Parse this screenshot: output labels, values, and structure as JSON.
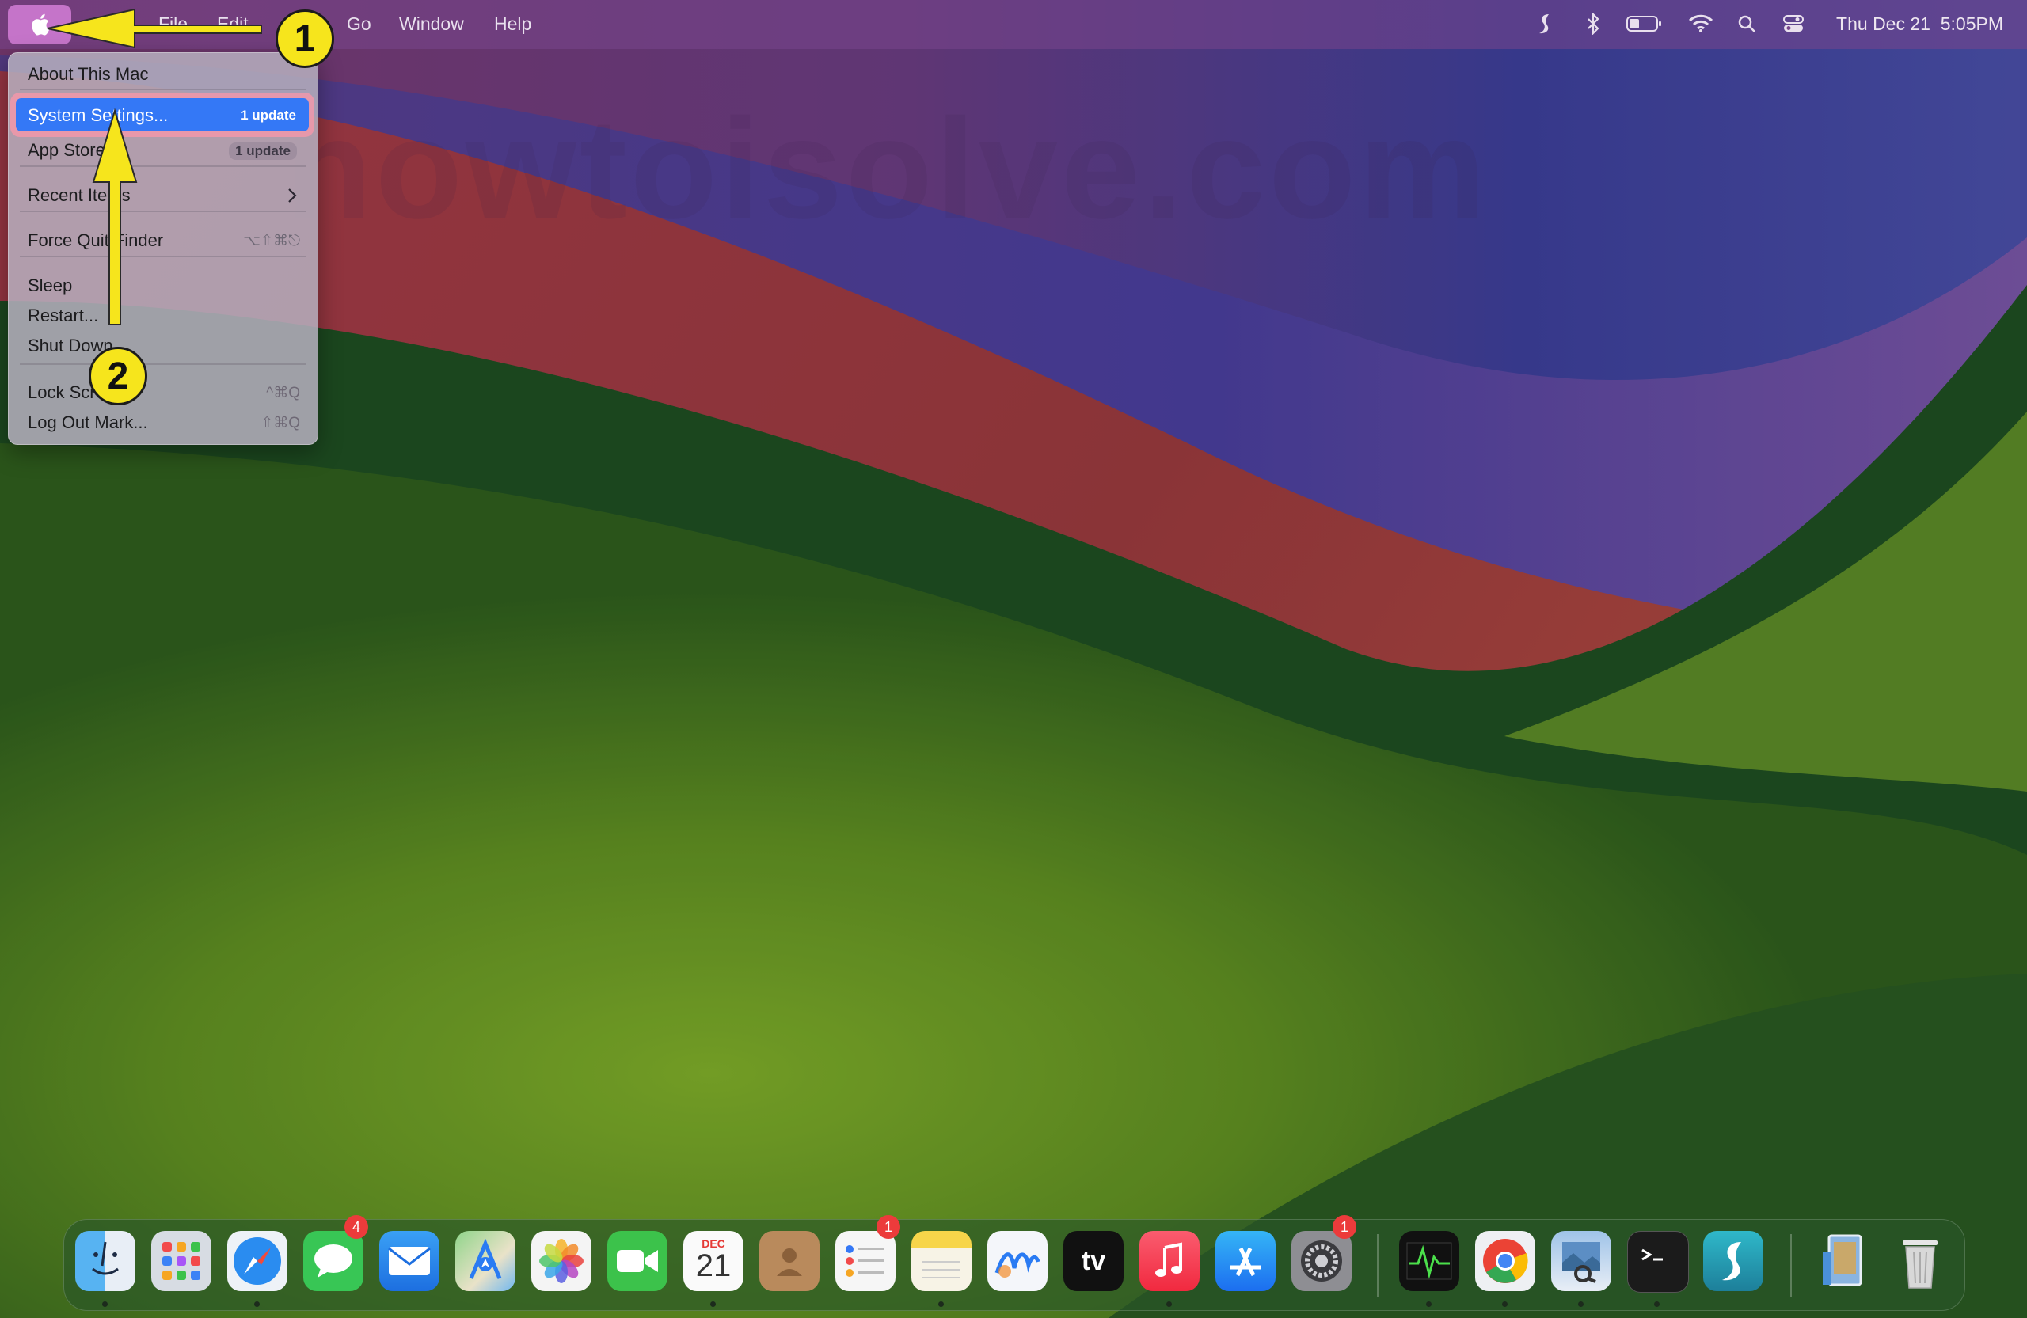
{
  "watermark": "howtoisolve.com",
  "menubar": {
    "menus": [
      "File",
      "Edit",
      "Go",
      "Window",
      "Help"
    ],
    "status_icons": [
      "surfshark-icon",
      "bluetooth-icon",
      "battery-icon",
      "wifi-icon",
      "search-icon",
      "control-center-icon"
    ],
    "clock_date": "Thu Dec 21",
    "clock_time": "5:05PM"
  },
  "apple_menu": {
    "about": "About This Mac",
    "system_settings": "System Settings...",
    "system_settings_badge": "1 update",
    "app_store": "App Store...",
    "app_store_badge": "1 update",
    "recent_items": "Recent Items",
    "force_quit": "Force Quit Finder",
    "force_quit_shortcut": "⌥⇧⌘⎋",
    "sleep": "Sleep",
    "restart": "Restart...",
    "shut_down": "Shut Down...",
    "lock_screen": "Lock Screen",
    "lock_screen_shortcut": "^⌘Q",
    "log_out": "Log Out Mark...",
    "log_out_shortcut": "⇧⌘Q"
  },
  "annotations": {
    "step1": "1",
    "step2": "2",
    "arrow_color": "#f6e51c"
  },
  "dock": {
    "apps": [
      "Finder",
      "Launchpad",
      "Safari",
      "Messages",
      "Mail",
      "Maps",
      "Photos",
      "FaceTime",
      "Calendar",
      "Contacts",
      "Reminders",
      "Notes",
      "Freeform",
      "TV",
      "Music",
      "App Store",
      "System Settings",
      "Activity Monitor",
      "Google Chrome",
      "Preview",
      "Terminal",
      "Surfshark",
      "Downloads",
      "Trash"
    ],
    "messages_badge": "4",
    "reminders_badge": "1",
    "settings_badge": "1",
    "calendar_month": "DEC",
    "calendar_day": "21",
    "tv_label": "tv"
  }
}
